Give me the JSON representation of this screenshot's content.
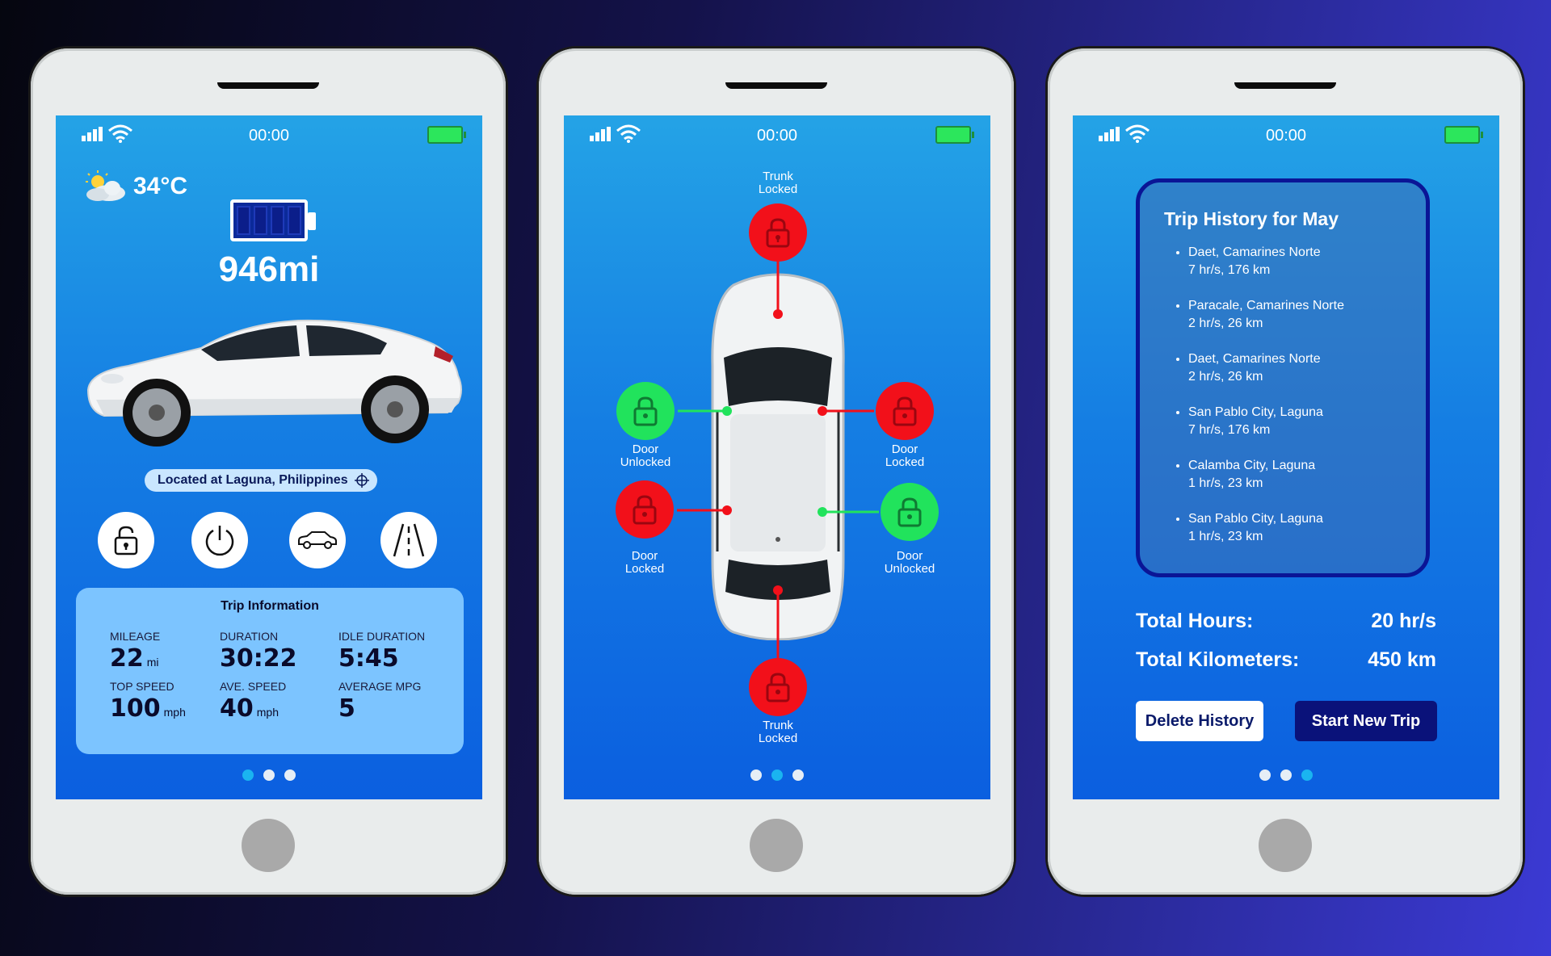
{
  "status_bar": {
    "time": "00:00"
  },
  "screen1": {
    "temperature": "34°C",
    "range": "946mi",
    "location": "Located at Laguna, Philippines",
    "action_icons": [
      "unlock-icon",
      "power-icon",
      "car-icon",
      "road-icon"
    ],
    "trip": {
      "title": "Trip Information",
      "stats": [
        {
          "label": "MILEAGE",
          "value": "22",
          "unit": "mi"
        },
        {
          "label": "DURATION",
          "value": "30:22",
          "unit": ""
        },
        {
          "label": "IDLE DURATION",
          "value": "5:45",
          "unit": ""
        },
        {
          "label": "TOP SPEED",
          "value": "100",
          "unit": "mph"
        },
        {
          "label": "AVE. SPEED",
          "value": "40",
          "unit": "mph"
        },
        {
          "label": "AVERAGE MPG",
          "value": "5",
          "unit": ""
        }
      ]
    },
    "active_page": 0
  },
  "screen2": {
    "locks": {
      "trunk_top": {
        "line1": "Trunk",
        "line2": "Locked",
        "state": "locked",
        "color": "#f2101a"
      },
      "door_left_front": {
        "line1": "Door",
        "line2": "Unlocked",
        "state": "unlocked",
        "color": "#21e35c"
      },
      "door_right_front": {
        "line1": "Door",
        "line2": "Locked",
        "state": "locked",
        "color": "#f2101a"
      },
      "door_left_rear": {
        "line1": "Door",
        "line2": "Locked",
        "state": "locked",
        "color": "#f2101a"
      },
      "door_right_rear": {
        "line1": "Door",
        "line2": "Unlocked",
        "state": "unlocked",
        "color": "#21e35c"
      },
      "trunk_bottom": {
        "line1": "Trunk",
        "line2": "Locked",
        "state": "locked",
        "color": "#f2101a"
      }
    },
    "active_page": 1
  },
  "screen3": {
    "title": "Trip History for May",
    "trips": [
      {
        "place": "Daet, Camarines Norte",
        "detail": "7 hr/s, 176 km"
      },
      {
        "place": "Paracale, Camarines Norte",
        "detail": "2 hr/s, 26 km"
      },
      {
        "place": "Daet, Camarines Norte",
        "detail": "2 hr/s, 26 km"
      },
      {
        "place": "San Pablo City, Laguna",
        "detail": "7 hr/s, 176 km"
      },
      {
        "place": "Calamba City, Laguna",
        "detail": "1 hr/s, 23 km"
      },
      {
        "place": "San Pablo City, Laguna",
        "detail": "1 hr/s, 23 km"
      }
    ],
    "total_hours_label": "Total Hours:",
    "total_hours_value": "20 hr/s",
    "total_km_label": "Total Kilometers:",
    "total_km_value": "450 km",
    "delete_label": "Delete History",
    "start_label": "Start New Trip",
    "active_page": 2
  },
  "colors": {
    "locked": "#f2101a",
    "unlocked": "#21e35c",
    "accent_dot": "#1ab4f0",
    "navy": "#0a127a"
  }
}
